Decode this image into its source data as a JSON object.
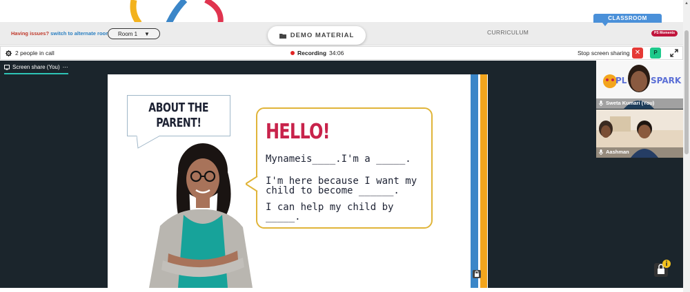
{
  "topbar": {
    "issue_text": "Having issues?",
    "issue_link": "switch to alternate room",
    "room_value": "Room 1",
    "demo_button": "DEMO MATERIAL",
    "curriculum_label": "CURRICULUM",
    "classroom_label": "CLASSROOM",
    "moments_label": "PS Moments"
  },
  "callbar": {
    "people_count": "2 people in call",
    "recording_label": "Recording",
    "recording_time": "34:06",
    "stop_sharing": "Stop screen sharing",
    "p_button": "P"
  },
  "stage": {
    "share_tab": "Screen share (You)",
    "share_menu": "⋯"
  },
  "slide": {
    "about_line1": "ABOUT THE",
    "about_line2": "PARENT!",
    "hello": "HELLO!",
    "line1": "Mynameis____.I'm a _____.",
    "line2a": "I'm here because I want my",
    "line2b": "child to become ______.",
    "line3": "I can help my child by _____."
  },
  "participants": [
    {
      "name": "Sweta Kumari (You)",
      "logo": "PL",
      "logo_tail": "SPARK"
    },
    {
      "name": "Aashman"
    }
  ],
  "colors": {
    "accent_blue": "#4a90d9",
    "record_red": "#e02424",
    "stop_red": "#e53935",
    "p_green": "#1ec98b",
    "stage_bg": "#1b252c",
    "hello_red": "#c8234b",
    "box_gold": "#e0b438"
  }
}
